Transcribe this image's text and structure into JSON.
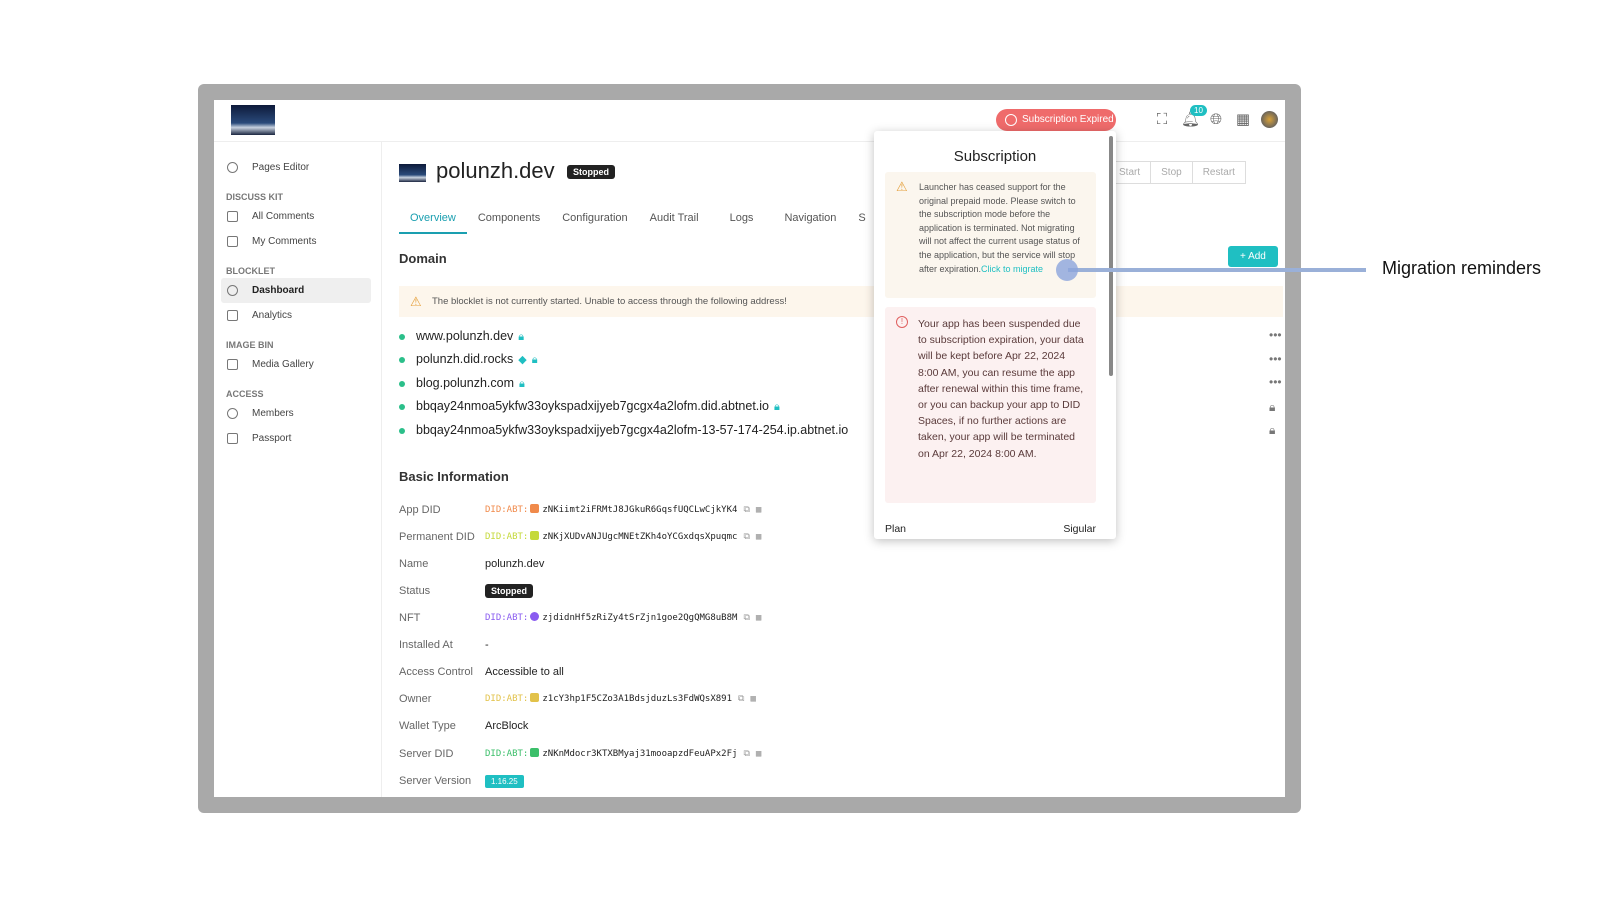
{
  "header": {
    "subscription_status": "Subscription Expired",
    "notification_count": "10"
  },
  "sidebar": {
    "top_item": "Pages Editor",
    "groups": [
      {
        "label": "DISCUSS KIT",
        "items": [
          "All Comments",
          "My Comments"
        ]
      },
      {
        "label": "BLOCKLET",
        "items": [
          "Dashboard",
          "Analytics"
        ]
      },
      {
        "label": "IMAGE BIN",
        "items": [
          "Media Gallery"
        ]
      },
      {
        "label": "ACCESS",
        "items": [
          "Members",
          "Passport"
        ]
      }
    ],
    "active": "Dashboard"
  },
  "page": {
    "title": "polunzh.dev",
    "status": "Stopped",
    "actions": [
      "Start",
      "Stop",
      "Restart"
    ],
    "tabs": [
      "Overview",
      "Components",
      "Configuration",
      "Audit Trail",
      "Logs",
      "Navigation",
      "S"
    ],
    "domain_heading": "Domain",
    "add_label": "+ Add",
    "domain_warning": "The blocklet is not currently started. Unable to access through the following address!",
    "domains": [
      "www.polunzh.dev",
      "polunzh.did.rocks",
      "blog.polunzh.com",
      "bbqay24nmoa5ykfw33oykspadxijyeb7gcgx4a2lofm.did.abtnet.io",
      "bbqay24nmoa5ykfw33oykspadxijyeb7gcgx4a2lofm-13-57-174-254.ip.abtnet.io"
    ],
    "basic_heading": "Basic Information",
    "info": {
      "app_did": {
        "label": "App DID",
        "prefix": "DID:ABT:",
        "value": "zNKiimt2iFRMtJ8JGkuR6GqsfUQCLwCjkYK4",
        "color": "#f08a4b"
      },
      "permanent_did": {
        "label": "Permanent DID",
        "prefix": "DID:ABT:",
        "value": "zNKjXUDvANJUgcMNEtZKh4oYCGxdqsXpuqmc",
        "color": "#c5d93a"
      },
      "name": {
        "label": "Name",
        "value": "polunzh.dev"
      },
      "status": {
        "label": "Status",
        "value": "Stopped"
      },
      "nft": {
        "label": "NFT",
        "prefix": "DID:ABT:",
        "value": "zjdidnHf5zRiZy4tSrZjn1goe2QgQMG8uB8M",
        "color": "#8a5cf0"
      },
      "installed_at": {
        "label": "Installed At",
        "value": "-"
      },
      "access_control": {
        "label": "Access Control",
        "value": "Accessible to all"
      },
      "owner": {
        "label": "Owner",
        "prefix": "DID:ABT:",
        "value": "z1cY3hp1F5CZo3A1BdsjduzLs3FdWQsX891",
        "color": "#e2c24a"
      },
      "wallet_type": {
        "label": "Wallet Type",
        "value": "ArcBlock"
      },
      "server_did": {
        "label": "Server DID",
        "prefix": "DID:ABT:",
        "value": "zNKnMdocr3KTXBMyaj31mooapzdFeuAPx2Fj",
        "color": "#3bbf6a"
      },
      "server_version": {
        "label": "Server Version",
        "value": "1.16.25"
      }
    }
  },
  "popover": {
    "title": "Subscription",
    "migration_notice": "Launcher has ceased support for the original prepaid mode. Please switch to the subscription mode before the application is terminated. Not migrating will not affect the current usage status of the application, but the service will stop after expiration.",
    "migrate_link": "Click to migrate",
    "suspension_notice": "Your app has been suspended due to subscription expiration, your data will be kept before Apr 22, 2024 8:00 AM, you can resume the app after renewal within this time frame, or you can backup your app to DID Spaces, if no further actions are taken, your app will be terminated on Apr 22, 2024 8:00 AM.",
    "plan_label": "Plan",
    "plan_value": "Sigular"
  },
  "annotation": "Migration reminders"
}
